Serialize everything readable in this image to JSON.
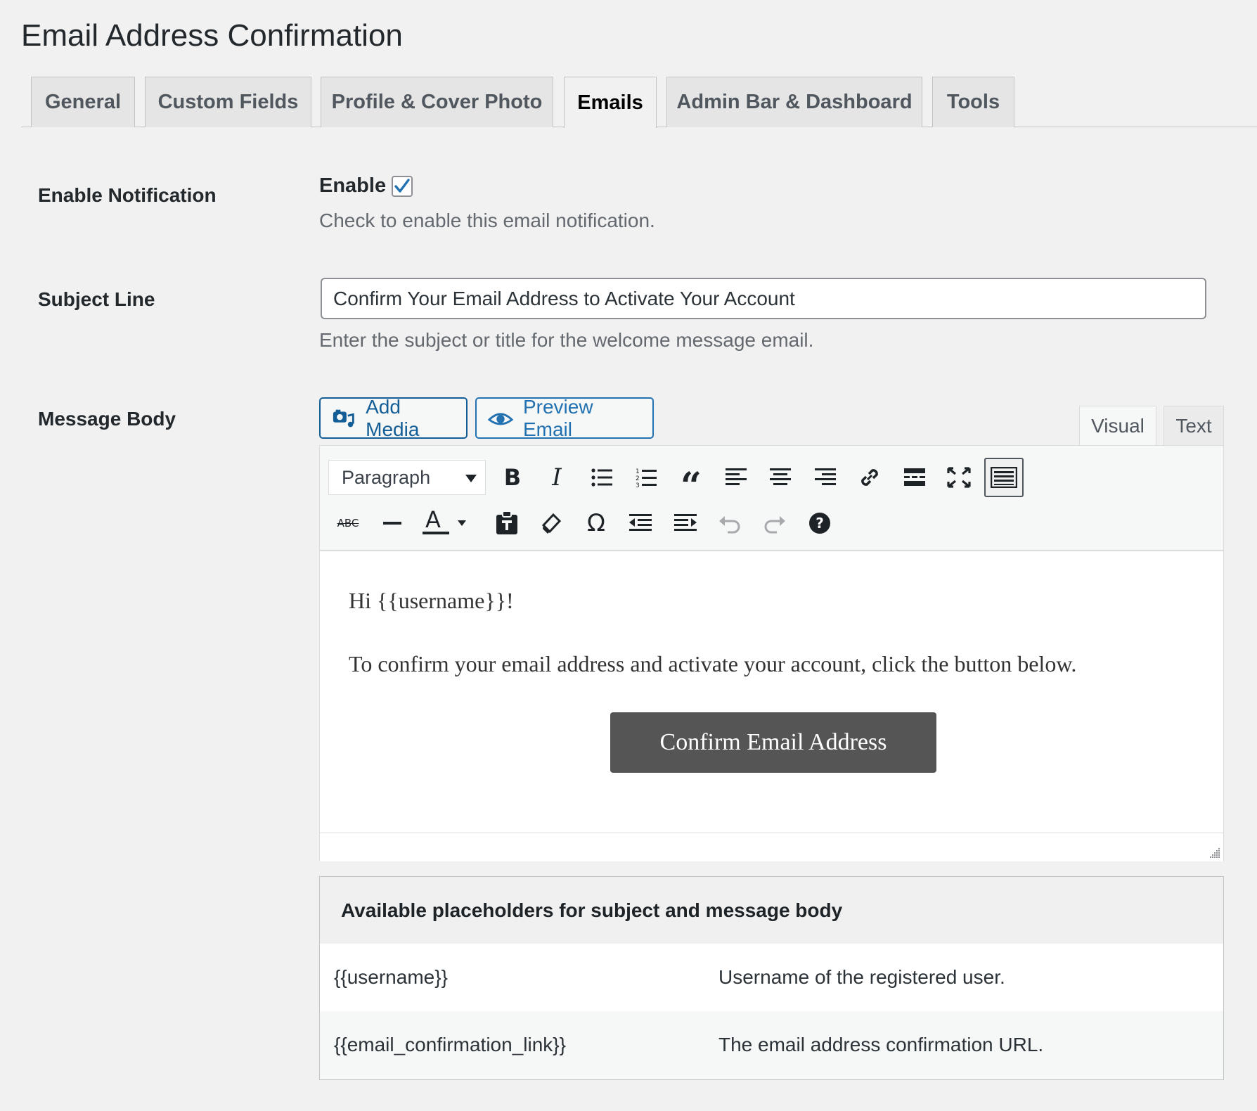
{
  "page": {
    "title": "Email Address Confirmation"
  },
  "tabs": [
    {
      "label": "General",
      "active": false
    },
    {
      "label": "Custom Fields",
      "active": false
    },
    {
      "label": "Profile & Cover Photo",
      "active": false
    },
    {
      "label": "Emails",
      "active": true
    },
    {
      "label": "Admin Bar & Dashboard",
      "active": false
    },
    {
      "label": "Tools",
      "active": false
    }
  ],
  "enable_notification": {
    "label": "Enable Notification",
    "checkbox_label": "Enable",
    "checked": true,
    "description": "Check to enable this email notification."
  },
  "subject_line": {
    "label": "Subject Line",
    "value": "Confirm Your Email Address to Activate Your Account",
    "description": "Enter the subject or title for the welcome message email."
  },
  "message_body": {
    "label": "Message Body",
    "add_media_label": "Add Media",
    "preview_label": "Preview Email",
    "mode_tabs": [
      {
        "label": "Visual",
        "active": true
      },
      {
        "label": "Text",
        "active": false
      }
    ],
    "format_select": "Paragraph",
    "toolbar_row1": [
      "bold-icon",
      "italic-icon",
      "bulleted-list-icon",
      "numbered-list-icon",
      "blockquote-icon",
      "align-left-icon",
      "align-center-icon",
      "align-right-icon",
      "link-icon",
      "read-more-icon",
      "fullscreen-icon",
      "toolbar-toggle-icon"
    ],
    "toolbar_row2": [
      "strikethrough-icon",
      "horizontal-line-icon",
      "text-color-icon",
      "paste-text-icon",
      "clear-formatting-icon",
      "special-character-icon",
      "outdent-icon",
      "indent-icon",
      "undo-icon",
      "redo-icon",
      "help-icon"
    ],
    "content": {
      "greeting": "Hi {{username}}!",
      "paragraph": "To confirm your email address and activate your account, click the button below.",
      "button_label": "Confirm Email Address"
    }
  },
  "placeholders": {
    "heading": "Available placeholders for subject and message body",
    "rows": [
      {
        "token": "{{username}}",
        "description": "Username of the registered user."
      },
      {
        "token": "{{email_confirmation_link}}",
        "description": "The email address confirmation URL."
      }
    ]
  },
  "colors": {
    "accent": "#2271b1",
    "button_dark": "#555555",
    "background": "#f1f1f1"
  }
}
